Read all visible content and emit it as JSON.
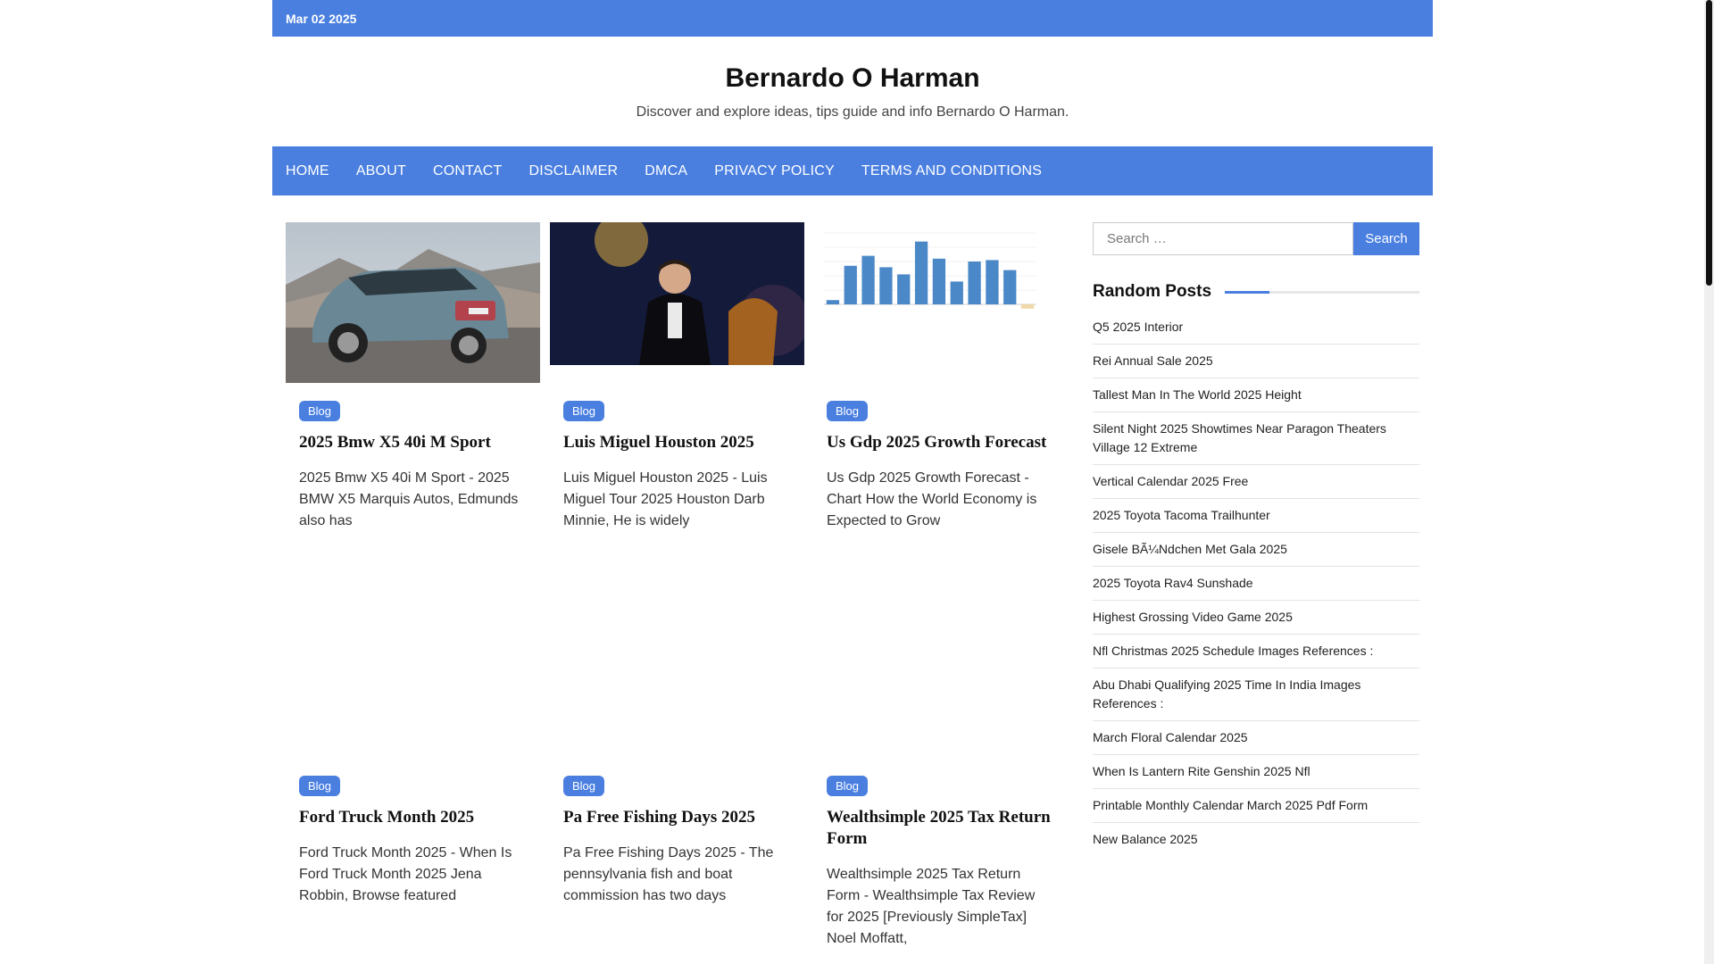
{
  "topbar": {
    "date": "Mar 02 2025"
  },
  "site": {
    "title": "Bernardo O Harman",
    "tagline": "Discover and explore ideas, tips guide and info Bernardo O Harman."
  },
  "nav": {
    "items": [
      "HOME",
      "ABOUT",
      "CONTACT",
      "DISCLAIMER",
      "DMCA",
      "PRIVACY POLICY",
      "TERMS AND CONDITIONS"
    ]
  },
  "posts": [
    {
      "category": "Blog",
      "title": "2025 Bmw X5 40i M Sport",
      "excerpt": "2025 Bmw X5 40i M Sport - 2025 BMW X5 Marquis Autos, Edmunds also has"
    },
    {
      "category": "Blog",
      "title": "Luis Miguel Houston 2025",
      "excerpt": "Luis Miguel Houston 2025 - Luis Miguel Tour 2025 Houston Darb Minnie, He is widely"
    },
    {
      "category": "Blog",
      "title": "Us Gdp 2025 Growth Forecast",
      "excerpt": "Us Gdp 2025 Growth Forecast - Chart How the World Economy is Expected to Grow"
    },
    {
      "category": "Blog",
      "title": "Ford Truck Month 2025",
      "excerpt": "Ford Truck Month 2025 - When Is Ford Truck Month 2025 Jena Robbin, Browse featured"
    },
    {
      "category": "Blog",
      "title": "Pa Free Fishing Days 2025",
      "excerpt": "Pa Free Fishing Days 2025 - The pennsylvania fish and boat commission has two days"
    },
    {
      "category": "Blog",
      "title": "Wealthsimple 2025 Tax Return Form",
      "excerpt": "Wealthsimple 2025 Tax Return Form - Wealthsimple Tax Review for 2025 [Previously SimpleTax] Noel Moffatt,"
    }
  ],
  "gdp_thumb": {
    "values": [
      0.3,
      2.7,
      3.4,
      2.6,
      2.1,
      4.4,
      3.2,
      1.6,
      3.0,
      3.1,
      2.4,
      -0.3
    ],
    "bar_color": "#4a88c7",
    "neg_color": "#f0d8a8"
  },
  "search": {
    "placeholder": "Search …",
    "button": "Search"
  },
  "random_posts": {
    "title": "Random Posts",
    "items": [
      "Q5 2025 Interior",
      "Rei Annual Sale 2025",
      "Tallest Man In The World 2025 Height",
      "Silent Night 2025 Showtimes Near Paragon Theaters Village 12 Extreme",
      "Vertical Calendar 2025 Free",
      "2025 Toyota Tacoma Trailhunter",
      "Gisele BÃ¼Ndchen Met Gala 2025",
      "2025 Toyota Rav4 Sunshade",
      "Highest Grossing Video Game 2025",
      "Nfl Christmas 2025 Schedule Images References :",
      "Abu Dhabi Qualifying 2025 Time In India Images References :",
      "March Floral Calendar 2025",
      "When Is Lantern Rite Genshin 2025 Nfl",
      "Printable Monthly Calendar March 2025 Pdf Form",
      "New Balance 2025"
    ]
  },
  "colors": {
    "accent": "#4a7fe0"
  }
}
